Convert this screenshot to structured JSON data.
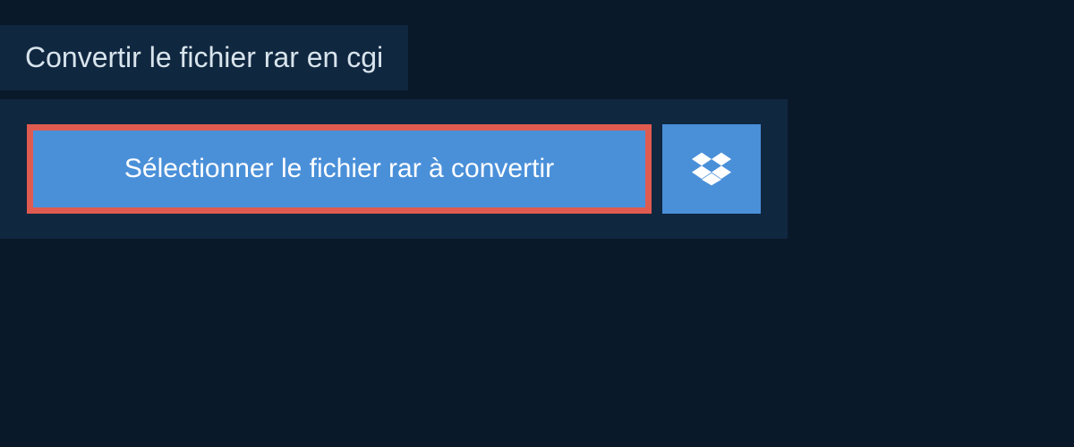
{
  "header": {
    "title": "Convertir le fichier rar en cgi"
  },
  "upload": {
    "select_label": "Sélectionner le fichier rar à convertir"
  },
  "colors": {
    "background_dark": "#0a1929",
    "panel": "#102740",
    "button_primary": "#4a90d9",
    "button_highlight_border": "#e05b4f",
    "text_light": "#d8e4ec",
    "text_white": "#ffffff"
  }
}
